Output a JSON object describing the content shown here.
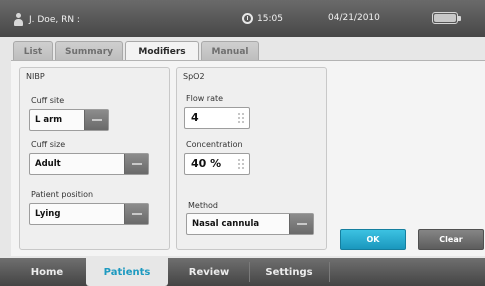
{
  "status_bar": {
    "user": "J. Doe, RN :",
    "time": "15:05",
    "date": "04/21/2010",
    "icons": [
      "user-icon",
      "clock-icon",
      "battery-icon"
    ]
  },
  "tabs": [
    {
      "label": "List"
    },
    {
      "label": "Summary"
    },
    {
      "label": "Modifiers"
    },
    {
      "label": "Manual"
    }
  ],
  "active_tab": "Modifiers",
  "nibp": {
    "title": "NIBP",
    "cuff_site_label": "Cuff site",
    "cuff_site_value": "L arm",
    "cuff_size_label": "Cuff size",
    "cuff_size_value": "Adult",
    "patient_position_label": "Patient position",
    "patient_position_value": "Lying"
  },
  "spo2": {
    "title": "SpO2",
    "flow_rate_label": "Flow rate",
    "flow_rate_value": "4",
    "concentration_label": "Concentration",
    "concentration_value": "40 %",
    "method_label": "Method",
    "method_value": "Nasal cannula"
  },
  "actions": {
    "ok_label": "OK",
    "clear_label": "Clear"
  },
  "bottom_nav": [
    {
      "label": "Home"
    },
    {
      "label": "Patients"
    },
    {
      "label": "Review"
    },
    {
      "label": "Settings"
    }
  ],
  "active_nav": "Patients",
  "colors": {
    "accent": "#1e9ac0",
    "ok_button": "#2bb0d4",
    "status_bar": "#555555"
  }
}
